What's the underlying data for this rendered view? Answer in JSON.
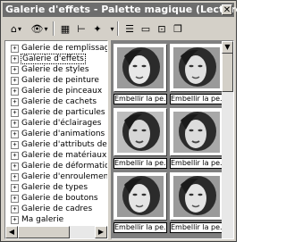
{
  "window": {
    "title": "Galerie d'effets - Palette magique (Lecture seule)",
    "close_glyph": "✕"
  },
  "toolbar": {
    "buttons": [
      {
        "icon": "gallery-view-icon",
        "glyph": "⌂"
      },
      {
        "icon": "eye-icon",
        "glyph": "👁"
      },
      {
        "icon": "grid-view-icon",
        "glyph": "▦"
      },
      {
        "icon": "tree-view-icon",
        "glyph": "⊢"
      },
      {
        "icon": "wand-icon",
        "glyph": "✦"
      },
      {
        "icon": "list-icon",
        "glyph": "☰"
      },
      {
        "icon": "single-frame-icon",
        "glyph": "▭"
      },
      {
        "icon": "edit-frame-icon",
        "glyph": "⊡"
      },
      {
        "icon": "copy-icon",
        "glyph": "❐"
      }
    ],
    "dropdown_caret": "▾"
  },
  "tree": {
    "expand_glyph": "+",
    "items": [
      {
        "label": "Galerie de remplissages"
      },
      {
        "label": "Galerie d'effets",
        "selected": true
      },
      {
        "label": "Galerie de styles"
      },
      {
        "label": "Galerie de peinture"
      },
      {
        "label": "Galerie de pinceaux"
      },
      {
        "label": "Galerie de cachets"
      },
      {
        "label": "Galerie de particules"
      },
      {
        "label": "Galerie d'éclairages"
      },
      {
        "label": "Galerie d'animations"
      },
      {
        "label": "Galerie d'attributs de ma"
      },
      {
        "label": "Galerie de matériaux"
      },
      {
        "label": "Galerie de déformations"
      },
      {
        "label": "Galerie d'enroulements"
      },
      {
        "label": "Galerie de types"
      },
      {
        "label": "Galerie de boutons"
      },
      {
        "label": "Galerie de cadres"
      },
      {
        "label": "Ma galerie"
      }
    ],
    "scroll_left": "◀",
    "scroll_right": "▶"
  },
  "gallery": {
    "items": [
      {
        "caption": "Embellir la pe..."
      },
      {
        "caption": "Embellir la pe..."
      },
      {
        "caption": "Embellir la pe..."
      },
      {
        "caption": "Embellir la pe..."
      },
      {
        "caption": "Embellir la pe..."
      },
      {
        "caption": "Embellir la pe..."
      }
    ],
    "scroll_up": "▲",
    "scroll_down": "▼"
  }
}
